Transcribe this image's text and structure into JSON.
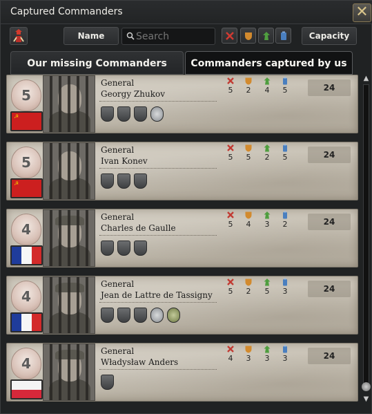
{
  "window": {
    "title": "Captured Commanders",
    "close_icon": "close-icon"
  },
  "toolbar": {
    "sort_by_name_label": "Name",
    "search": {
      "placeholder": "Search",
      "value": ""
    },
    "filters": [
      "attack",
      "defense",
      "planning",
      "logistics"
    ],
    "capacity_label": "Capacity"
  },
  "tabs": [
    {
      "label": "Our missing Commanders",
      "active": false
    },
    {
      "label": "Commanders captured by us",
      "active": true
    }
  ],
  "stat_colors": {
    "attack": "#c23b33",
    "defense": "#d28a2e",
    "planning": "#4f9e3f",
    "logistics": "#4a7fbf"
  },
  "commanders": [
    {
      "skill": "5",
      "country": "soviet",
      "rank": "General",
      "name": "Georgy Zhukov",
      "stats": {
        "attack": "5",
        "defense": "2",
        "planning": "4",
        "logistics": "5"
      },
      "capacity": "24",
      "traits": [
        "shield",
        "shield",
        "shield",
        "medal"
      ]
    },
    {
      "skill": "5",
      "country": "soviet",
      "rank": "General",
      "name": "Ivan Konev",
      "stats": {
        "attack": "5",
        "defense": "5",
        "planning": "2",
        "logistics": "5"
      },
      "capacity": "24",
      "traits": [
        "shield",
        "shield",
        "shield"
      ]
    },
    {
      "skill": "4",
      "country": "france",
      "rank": "General",
      "name": "Charles de Gaulle",
      "stats": {
        "attack": "5",
        "defense": "4",
        "planning": "3",
        "logistics": "2"
      },
      "capacity": "24",
      "traits": [
        "shield",
        "shield",
        "shield"
      ]
    },
    {
      "skill": "4",
      "country": "france",
      "rank": "General",
      "name": "Jean de Lattre de Tassigny",
      "stats": {
        "attack": "5",
        "defense": "2",
        "planning": "5",
        "logistics": "3"
      },
      "capacity": "24",
      "traits": [
        "shield",
        "shield",
        "shield",
        "medal",
        "medal2"
      ]
    },
    {
      "skill": "4",
      "country": "poland",
      "rank": "General",
      "name": "Władysław Anders",
      "stats": {
        "attack": "4",
        "defense": "3",
        "planning": "3",
        "logistics": "3"
      },
      "capacity": "24",
      "traits": [
        "shield"
      ]
    }
  ]
}
